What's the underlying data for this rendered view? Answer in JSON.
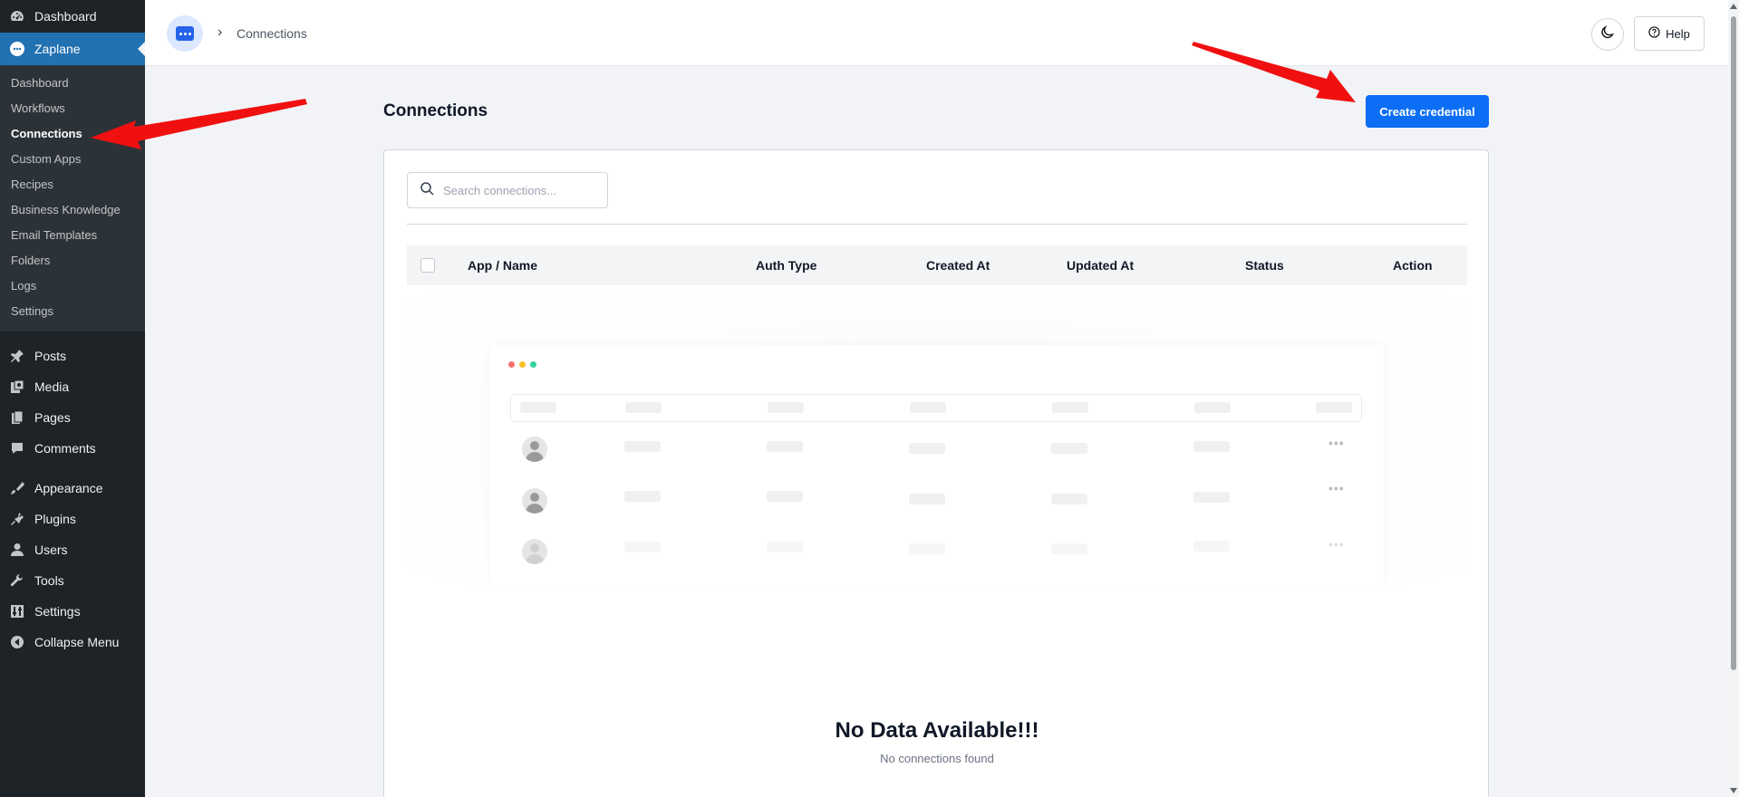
{
  "sidebar": {
    "top": [
      {
        "label": "Dashboard",
        "icon": "dashboard-icon"
      },
      {
        "label": "Zaplane",
        "icon": "zaplane-icon"
      }
    ],
    "submenu": [
      "Dashboard",
      "Workflows",
      "Connections",
      "Custom Apps",
      "Recipes",
      "Business Knowledge",
      "Email Templates",
      "Folders",
      "Logs",
      "Settings"
    ],
    "group1": [
      {
        "label": "Posts",
        "icon": "pin-icon"
      },
      {
        "label": "Media",
        "icon": "media-icon"
      },
      {
        "label": "Pages",
        "icon": "pages-icon"
      },
      {
        "label": "Comments",
        "icon": "comments-icon"
      }
    ],
    "group2": [
      {
        "label": "Appearance",
        "icon": "brush-icon"
      },
      {
        "label": "Plugins",
        "icon": "plugin-icon"
      },
      {
        "label": "Users",
        "icon": "user-icon"
      },
      {
        "label": "Tools",
        "icon": "wrench-icon"
      },
      {
        "label": "Settings",
        "icon": "settings-icon"
      },
      {
        "label": "Collapse Menu",
        "icon": "collapse-icon"
      }
    ]
  },
  "header": {
    "breadcrumb": "Connections",
    "help_label": "Help"
  },
  "main": {
    "title": "Connections",
    "create_label": "Create credential",
    "search_placeholder": "Search connections...",
    "columns": [
      "App / Name",
      "Auth Type",
      "Created At",
      "Updated At",
      "Status",
      "Action"
    ],
    "empty_title": "No Data Available!!!",
    "empty_subtitle": "No connections found"
  },
  "colors": {
    "sidebar_bg": "#1d2327",
    "active_menu": "#2271b1",
    "primary_button": "#0b6ef5",
    "annotation_arrow": "#f01010"
  }
}
